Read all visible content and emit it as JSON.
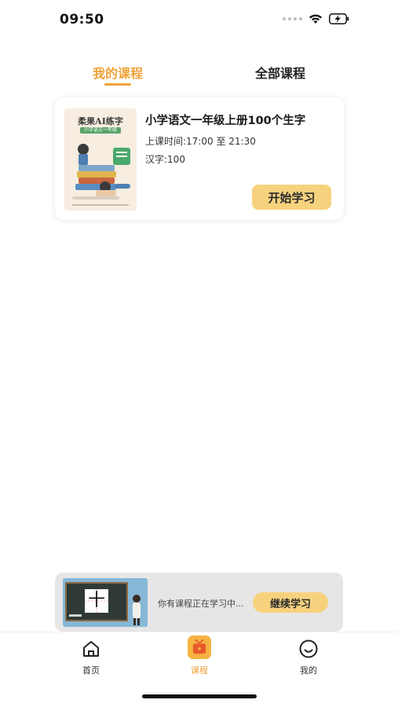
{
  "status_bar": {
    "time": "09:50"
  },
  "tabs": [
    {
      "label": "我的课程",
      "active": true
    },
    {
      "label": "全部课程",
      "active": false
    }
  ],
  "course": {
    "title": "小学语文一年级上册100个生字",
    "time": "上课时间:17:00 至 21:30",
    "count": "汉字:100",
    "start_button": "开始学习",
    "cover": {
      "title": "柔果AI练字",
      "subtitle": "小学语文一年级"
    }
  },
  "continue_bar": {
    "text": "你有课程正在学习中...",
    "button": "继续学习",
    "thumb_char": "十"
  },
  "bottom_nav": [
    {
      "label": "首页",
      "icon": "home-icon",
      "active": false
    },
    {
      "label": "课程",
      "icon": "course-tv-icon",
      "active": true
    },
    {
      "label": "我的",
      "icon": "smile-icon",
      "active": false
    }
  ],
  "colors": {
    "accent": "#f0a23a",
    "button_yellow": "#f7d27e",
    "banner_bg": "#e6e6e6"
  }
}
